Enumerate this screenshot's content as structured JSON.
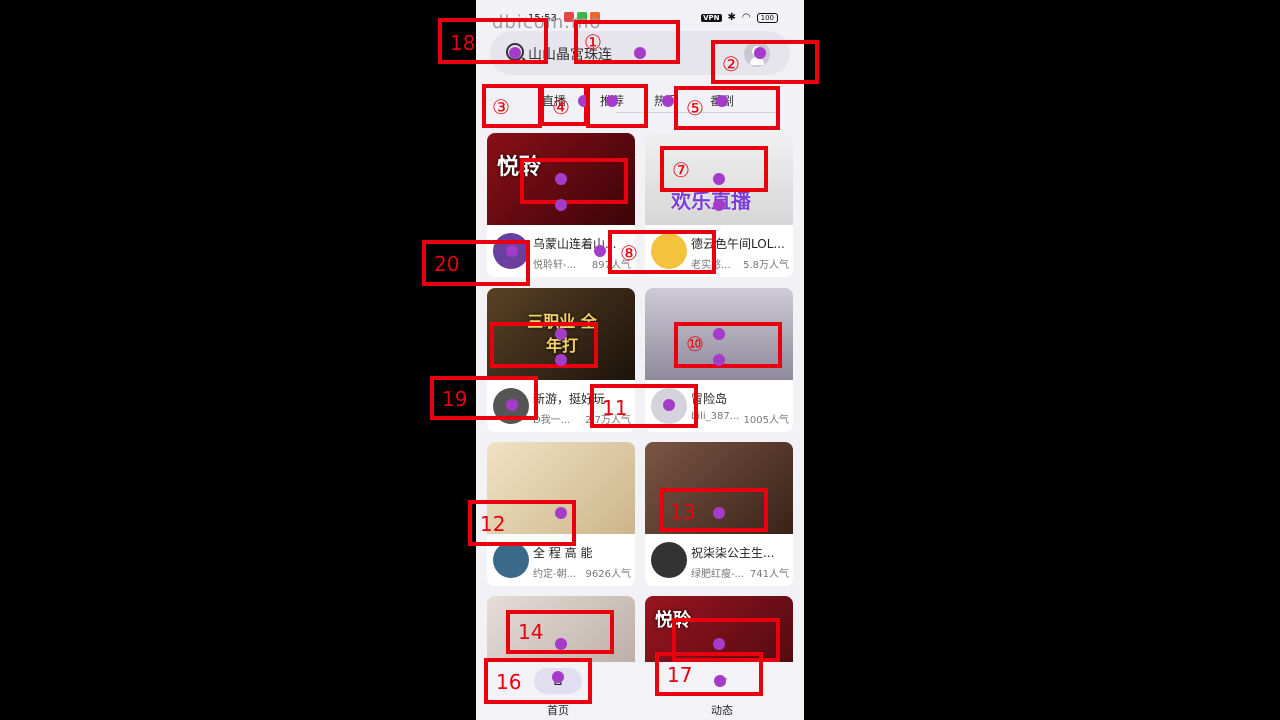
{
  "status_bar": {
    "time": "15:53",
    "vpn": "VPN",
    "battery": "100"
  },
  "watermark": "dbicom.mo",
  "search": {
    "text": "山山晶宫珠连",
    "avatar_icon": "user-avatar-icon",
    "search_icon": "search-icon"
  },
  "tabs": [
    {
      "label": "直播"
    },
    {
      "label": "推荐"
    },
    {
      "label": "热门"
    },
    {
      "label": "番剧"
    }
  ],
  "cards": [
    {
      "title": "乌蒙山连着山...",
      "name": "悦聆轩-...",
      "popularity": "897人气",
      "thumb_tag": "悦聆",
      "thumb_color": "#8a0f18",
      "avatar_color": "#6b3fa0"
    },
    {
      "title": "德云色午间LOL...",
      "name": "老实憨...",
      "popularity": "5.8万人气",
      "thumb_tag": "欢乐直播",
      "thumb_color": "#e6e6e6",
      "avatar_color": "#f4c23c"
    },
    {
      "title": "新游，挺好玩",
      "name": "D我一...",
      "popularity": "2.7万人气",
      "thumb_tag": "三职业 全年打",
      "thumb_color": "#3b2a18",
      "avatar_color": "#555555"
    },
    {
      "title": "冒险岛",
      "name": "bili_387...",
      "popularity": "1005人气",
      "thumb_tag": "",
      "thumb_color": "#b9b6c3",
      "avatar_color": "#d4d2dc"
    },
    {
      "title": "全 程 高 能",
      "name": "约定-朝...",
      "popularity": "9626人气",
      "thumb_tag": "",
      "thumb_color": "#e8d6b4",
      "avatar_color": "#3a6a8a"
    },
    {
      "title": "祝柒柒公主生...",
      "name": "绿肥红瘦-...",
      "popularity": "741人气",
      "thumb_tag": "",
      "thumb_color": "#5a3b2e",
      "avatar_color": "#333333"
    },
    {
      "title": "",
      "name": "",
      "popularity": "",
      "thumb_tag": "",
      "thumb_color": "#d9cfc9",
      "avatar_color": "#cccccc"
    },
    {
      "title": "",
      "name": "",
      "popularity": "",
      "thumb_tag": "悦聆",
      "thumb_color": "#7a0e18",
      "avatar_color": "#cccccc"
    }
  ],
  "nav": [
    {
      "label": "首页",
      "icon": "home-icon"
    },
    {
      "label": "动态",
      "icon": "star-icon"
    }
  ],
  "annotations": [
    "①",
    "②",
    "③",
    "④",
    "⑤",
    "⑦",
    "⑧",
    "⑩",
    "11",
    "12",
    "13",
    "14",
    "16",
    "17",
    "18",
    "19",
    "20"
  ]
}
